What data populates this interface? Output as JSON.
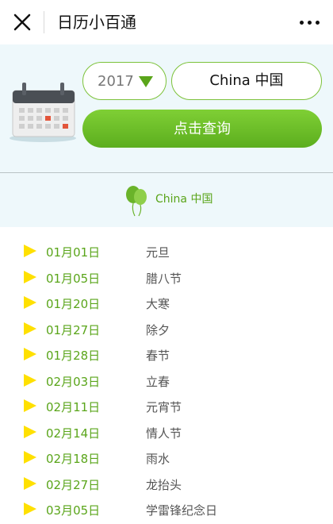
{
  "header": {
    "title": "日历小百通",
    "close_icon": "close-icon",
    "more_icon": "more-dots-icon"
  },
  "query": {
    "year_value": "2017",
    "country_value": "China 中国",
    "submit_label": "点击查询"
  },
  "result": {
    "country_label": "China 中国",
    "icon": "balloon-icon"
  },
  "holidays": [
    {
      "date": "01月01日",
      "name": "元旦"
    },
    {
      "date": "01月05日",
      "name": "腊八节"
    },
    {
      "date": "01月20日",
      "name": "大寒"
    },
    {
      "date": "01月27日",
      "name": "除夕"
    },
    {
      "date": "01月28日",
      "name": "春节"
    },
    {
      "date": "02月03日",
      "name": "立春"
    },
    {
      "date": "02月11日",
      "name": "元宵节"
    },
    {
      "date": "02月14日",
      "name": "情人节"
    },
    {
      "date": "02月18日",
      "name": "雨水"
    },
    {
      "date": "02月27日",
      "name": "龙抬头"
    },
    {
      "date": "03月05日",
      "name": "学雷锋纪念日"
    }
  ],
  "colors": {
    "accent_green": "#5aa51a",
    "button_green": "#72c22b",
    "marker_yellow": "#ffe000",
    "panel_bg": "#eef8fb"
  }
}
